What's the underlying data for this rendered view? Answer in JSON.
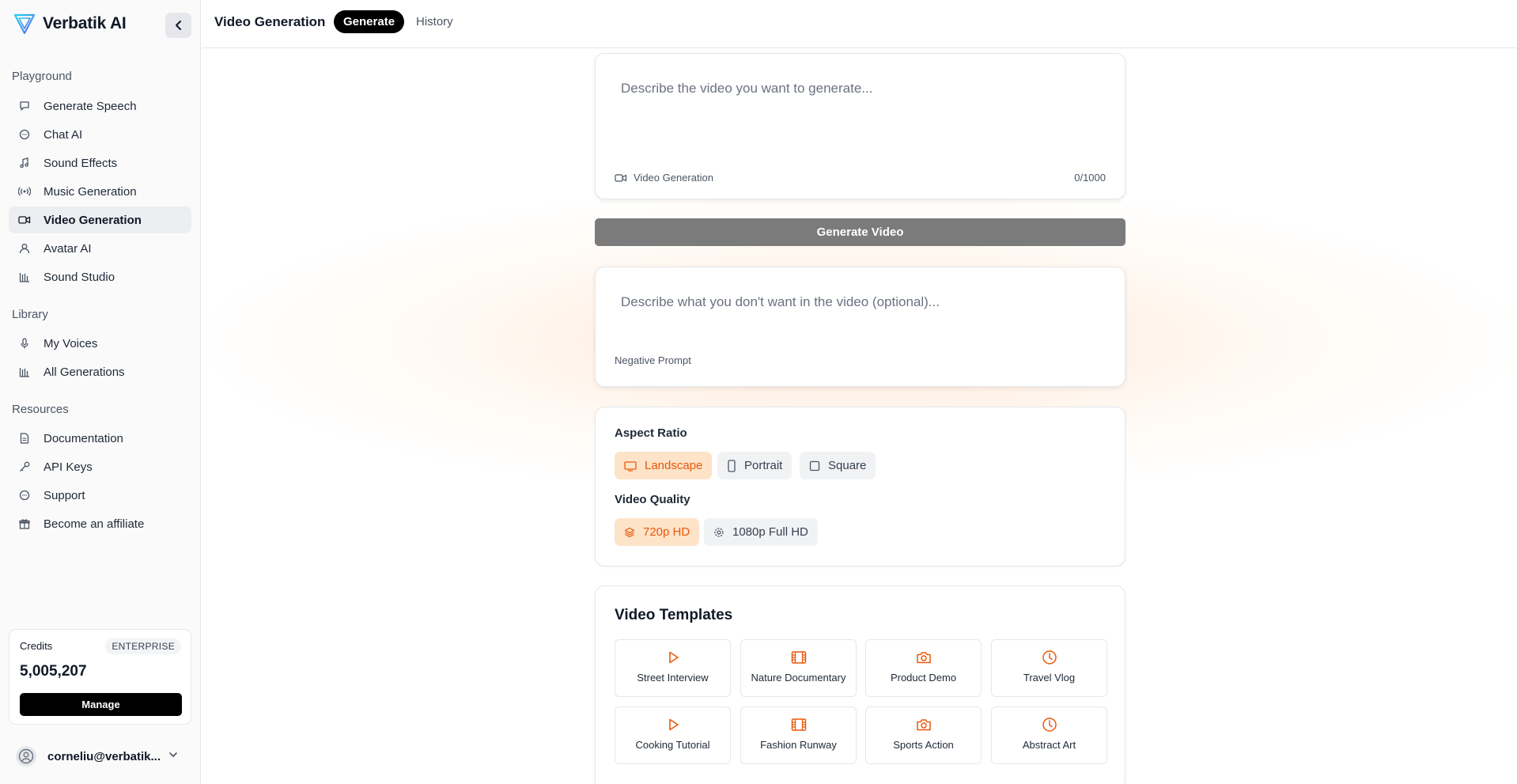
{
  "app": {
    "name": "Verbatik AI"
  },
  "sidebar": {
    "sections": [
      {
        "title": "Playground"
      },
      {
        "title": "Library"
      },
      {
        "title": "Resources"
      }
    ],
    "items": [
      {
        "label": "Generate Speech",
        "icon": "speech-bubble-icon"
      },
      {
        "label": "Chat AI",
        "icon": "chat-icon"
      },
      {
        "label": "Sound Effects",
        "icon": "music-note-icon"
      },
      {
        "label": "Music Generation",
        "icon": "broadcast-icon"
      },
      {
        "label": "Video Generation",
        "icon": "video-camera-icon",
        "active": true
      },
      {
        "label": "Avatar AI",
        "icon": "user-icon"
      },
      {
        "label": "Sound Studio",
        "icon": "bars-icon"
      },
      {
        "label": "My Voices",
        "icon": "microphone-icon"
      },
      {
        "label": "All Generations",
        "icon": "bars-icon"
      },
      {
        "label": "Documentation",
        "icon": "document-icon"
      },
      {
        "label": "API Keys",
        "icon": "key-icon"
      },
      {
        "label": "Support",
        "icon": "chat-icon"
      },
      {
        "label": "Become an affiliate",
        "icon": "gift-icon"
      }
    ],
    "credits": {
      "label": "Credits",
      "plan": "ENTERPRISE",
      "value": "5,005,207",
      "manage_label": "Manage"
    },
    "user": {
      "email": "corneliu@verbatik...."
    }
  },
  "header": {
    "title": "Video Generation",
    "tabs": [
      {
        "label": "Generate",
        "active": true
      },
      {
        "label": "History"
      }
    ]
  },
  "main": {
    "prompt": {
      "placeholder": "Describe the video you want to generate...",
      "mode_label": "Video Generation",
      "counter": "0/1000"
    },
    "generate_button": "Generate Video",
    "negative": {
      "placeholder": "Describe what you don't want in the video (optional)...",
      "label": "Negative Prompt"
    },
    "aspect_ratio": {
      "heading": "Aspect Ratio",
      "options": [
        {
          "label": "Landscape",
          "selected": true
        },
        {
          "label": "Portrait"
        },
        {
          "label": "Square"
        }
      ]
    },
    "quality": {
      "heading": "Video Quality",
      "options": [
        {
          "label": "720p HD",
          "selected": true
        },
        {
          "label": "1080p Full HD"
        }
      ]
    },
    "templates": {
      "heading": "Video Templates",
      "items": [
        {
          "label": "Street Interview",
          "icon": "play-icon"
        },
        {
          "label": "Nature Documentary",
          "icon": "film-icon"
        },
        {
          "label": "Product Demo",
          "icon": "camera-icon"
        },
        {
          "label": "Travel Vlog",
          "icon": "clock-icon"
        },
        {
          "label": "Cooking Tutorial",
          "icon": "play-icon"
        },
        {
          "label": "Fashion Runway",
          "icon": "film-icon"
        },
        {
          "label": "Sports Action",
          "icon": "camera-icon"
        },
        {
          "label": "Abstract Art",
          "icon": "clock-icon"
        }
      ]
    }
  },
  "colors": {
    "accent": "#ea580c",
    "accent_bg": "#fde3c8",
    "primary_button": "#000000",
    "disabled_button": "#7b7b7b"
  }
}
